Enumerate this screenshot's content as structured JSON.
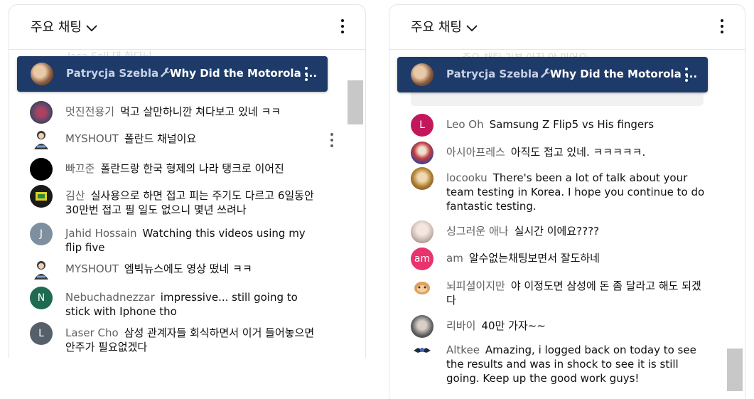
{
  "left_panel": {
    "header": {
      "title": "주요 채팅"
    },
    "ghost_text": "Jasa Sell  대 한다님",
    "pinned": {
      "author": "Patrycja Szebla",
      "title": "Why Did the Motorola ..."
    },
    "messages": [
      {
        "author": "멋진전용기",
        "text": "먹고 살만하니깐 쳐다보고 있네 ㅋㅋ",
        "avatar_color": "#5a4a6a"
      },
      {
        "author": "MYSHOUT",
        "text": "폴란드 채널이요",
        "avatar_color": "#ffffff"
      },
      {
        "author": "빠끄준",
        "text": "폴란드랑 한국 형제의 나라 탱크로 이어진",
        "avatar_color": "#000000"
      },
      {
        "author": "김산",
        "text": "실사용으로 하면 접고 피는 주기도 다르고 6일동안 30만번 접고 필 일도 없으니 몇년 쓰려나",
        "avatar_color": "#e0d020"
      },
      {
        "author": "Jahid Hossain",
        "text": "Watching this videos using my flip five",
        "avatar_letter": "J",
        "avatar_color": "#7e909f"
      },
      {
        "author": "MYSHOUT",
        "text": "엠빅뉴스에도 영상 떴네 ㅋㅋ",
        "avatar_color": "#ffffff"
      },
      {
        "author": "Nebuchadnezzar",
        "text": "impressive... still going to stick with Iphone tho",
        "avatar_letter": "N",
        "avatar_color": "#1e6b52"
      },
      {
        "author": "Laser Cho",
        "text": "삼성 관계자들 회식하면서 이거 들어놓으면 안주가 필요없겠다",
        "avatar_letter": "L",
        "avatar_color": "#56606b"
      }
    ]
  },
  "right_panel": {
    "header": {
      "title": "주요 채팅"
    },
    "ghost_text": "주요 채팅 기분 아직 안 미어요",
    "pinned": {
      "author": "Patrycja Szebla",
      "title": "Why Did the Motorola ..."
    },
    "messages": [
      {
        "author": "Leo Oh",
        "text": "Samsung Z Flip5 vs His fingers",
        "avatar_letter": "L",
        "avatar_color": "#c2185b"
      },
      {
        "author": "아시아프레스",
        "text": "아직도 접고 있네. ㅋㅋㅋㅋㅋ.",
        "avatar_color": "#a03030"
      },
      {
        "author": "locooku",
        "text": "There's been a lot of talk about your team testing in Korea. I hope you continue to do fantastic testing.",
        "avatar_color": "#b08030"
      },
      {
        "author": "싱그러운 애나",
        "text": "실시간 이에요????",
        "avatar_color": "#c9b8b0"
      },
      {
        "author": "am",
        "text": "알수없는채팅보면서 잘도하네",
        "avatar_letter": "am",
        "avatar_color": "#e8336e"
      },
      {
        "author": "뇌피셜이지만",
        "text": "야 이정도면 삼성에 돈 좀 달라고 해도 되겠다",
        "avatar_color": "#e0a060"
      },
      {
        "author": "리바이",
        "text": "40만 가자~~",
        "avatar_color": "#606060"
      },
      {
        "author": "Altkee",
        "text": "Amazing, i logged back on today to see the results and was in shock to see it is still going. Keep up the good work guys!",
        "avatar_color": "#202a40"
      }
    ]
  }
}
